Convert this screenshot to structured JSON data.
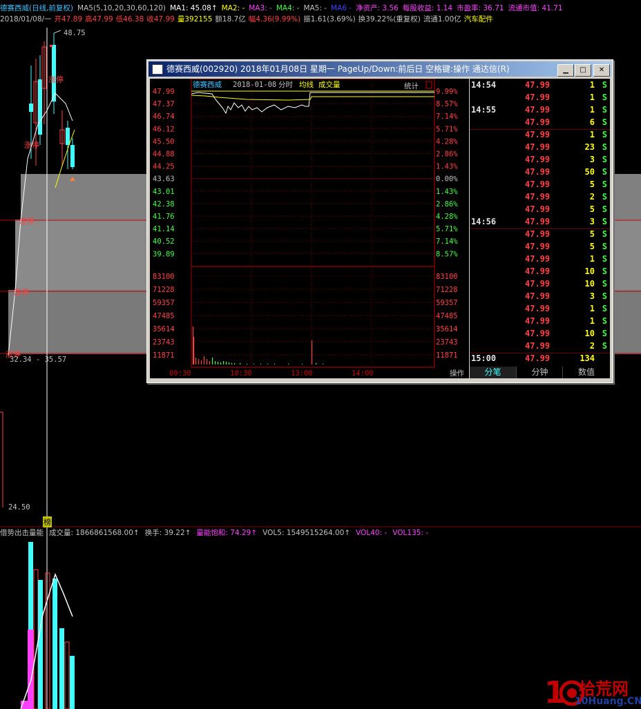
{
  "header": {
    "line1": [
      {
        "text": "德赛西威(日线,前复权)",
        "color": "#40c0ff"
      },
      {
        "text": "MA5(5,10,20,30,60,120)",
        "color": "#c0c0c0"
      },
      {
        "text": "MA1: 45.08↑",
        "color": "#ffffff"
      },
      {
        "text": "MA2: -",
        "color": "#ffff00"
      },
      {
        "text": "MA3: -",
        "color": "#ff40ff"
      },
      {
        "text": "MA4: -",
        "color": "#40ff40"
      },
      {
        "text": "MA5: -",
        "color": "#c0c0c0"
      },
      {
        "text": "MA6 -",
        "color": "#4040ff"
      },
      {
        "text": "净资产: 3.56",
        "color": "#ff40ff"
      },
      {
        "text": "每股收益: 1.14",
        "color": "#ff40ff"
      },
      {
        "text": "市盈率: 36.71",
        "color": "#ff40ff"
      },
      {
        "text": "流通市值: 41.71",
        "color": "#ff40ff"
      }
    ],
    "line2": [
      {
        "text": "2018/01/08/一",
        "color": "#c0c0c0"
      },
      {
        "text": "开47.89",
        "color": "#ff4040"
      },
      {
        "text": "高47.99",
        "color": "#ff4040"
      },
      {
        "text": "低46.38",
        "color": "#ff4040"
      },
      {
        "text": "收47.99",
        "color": "#ff4040"
      },
      {
        "text": "量392155",
        "color": "#ffff00"
      },
      {
        "text": "额18.7亿",
        "color": "#c0c0c0"
      },
      {
        "text": "幅4.36(9.99%)",
        "color": "#ff4040"
      },
      {
        "text": "振1.61(3.69%)",
        "color": "#c0c0c0"
      },
      {
        "text": "换39.22%(重复权)",
        "color": "#c0c0c0"
      },
      {
        "text": "流通1.00亿",
        "color": "#c0c0c0"
      },
      {
        "text": "汽车配件",
        "color": "#ffff00"
      }
    ]
  },
  "kline": {
    "high_label": "48.75",
    "low_label": "24.50",
    "range_label": "32.34 - 35.57",
    "limit_up_label": "涨停",
    "marker": "榜"
  },
  "volume_panel": {
    "items": [
      {
        "text": "借势出击量能",
        "color": "#c0c0c0"
      },
      {
        "text": "成交量: 1866861568.00↑",
        "color": "#c0c0c0"
      },
      {
        "text": "换手: 39.22↑",
        "color": "#c0c0c0"
      },
      {
        "text": "量能饱和: 74.29↑",
        "color": "#ff40ff"
      },
      {
        "text": "VOL5: 1549515264.00↑",
        "color": "#c0c0c0"
      },
      {
        "text": "VOL40: -",
        "color": "#ff40ff"
      },
      {
        "text": "VOL135: -",
        "color": "#ff40ff"
      }
    ]
  },
  "popup": {
    "title": "德赛西威(002920) 2018年01月08日 星期一 PageUp/Down:前后日 空格键:操作 通达信(R)",
    "chart_title": {
      "name": "德赛西威",
      "date": "2018-01-08",
      "type": "分时",
      "avg": "均线",
      "vol": "成交量",
      "stats": "统计"
    },
    "price_labels": [
      "47.99",
      "47.37",
      "46.74",
      "46.12",
      "45.50",
      "44.88",
      "44.25",
      "43.63",
      "43.01",
      "42.38",
      "41.76",
      "41.14",
      "40.52",
      "39.89"
    ],
    "pct_labels": [
      "9.99%",
      "8.57%",
      "7.14%",
      "5.71%",
      "4.28%",
      "2.86%",
      "1.43%",
      "0.00%",
      "1.43%",
      "2.86%",
      "4.28%",
      "5.71%",
      "7.14%",
      "8.57%"
    ],
    "vol_labels": [
      "83100",
      "71228",
      "59357",
      "47485",
      "35614",
      "23743",
      "11871"
    ],
    "time_labels": [
      "09:30",
      "10:30",
      "13:00",
      "14:00"
    ],
    "op_label": "操作",
    "tabs": [
      "分笔",
      "分钟",
      "数值"
    ],
    "ticks": [
      {
        "time": "14:54",
        "price": "47.99",
        "vol": "1",
        "dir": "S"
      },
      {
        "time": "",
        "price": "47.99",
        "vol": "1",
        "dir": "S"
      },
      {
        "time": "14:55",
        "price": "47.99",
        "vol": "1",
        "dir": "S"
      },
      {
        "time": "",
        "price": "47.99",
        "vol": "6",
        "dir": "S"
      },
      {
        "time": "",
        "price": "47.99",
        "vol": "1",
        "dir": "S"
      },
      {
        "time": "",
        "price": "47.99",
        "vol": "23",
        "dir": "S"
      },
      {
        "time": "",
        "price": "47.99",
        "vol": "3",
        "dir": "S"
      },
      {
        "time": "",
        "price": "47.99",
        "vol": "50",
        "dir": "S"
      },
      {
        "time": "",
        "price": "47.99",
        "vol": "5",
        "dir": "S"
      },
      {
        "time": "",
        "price": "47.99",
        "vol": "2",
        "dir": "S"
      },
      {
        "time": "",
        "price": "47.99",
        "vol": "5",
        "dir": "S"
      },
      {
        "time": "14:56",
        "price": "47.99",
        "vol": "3",
        "dir": "S"
      },
      {
        "time": "",
        "price": "47.99",
        "vol": "5",
        "dir": "S"
      },
      {
        "time": "",
        "price": "47.99",
        "vol": "5",
        "dir": "S"
      },
      {
        "time": "",
        "price": "47.99",
        "vol": "1",
        "dir": "S"
      },
      {
        "time": "",
        "price": "47.99",
        "vol": "10",
        "dir": "S"
      },
      {
        "time": "",
        "price": "47.99",
        "vol": "10",
        "dir": "S"
      },
      {
        "time": "",
        "price": "47.99",
        "vol": "3",
        "dir": "S"
      },
      {
        "time": "",
        "price": "47.99",
        "vol": "1",
        "dir": "S"
      },
      {
        "time": "",
        "price": "47.99",
        "vol": "1",
        "dir": "S"
      },
      {
        "time": "",
        "price": "47.99",
        "vol": "10",
        "dir": "S"
      },
      {
        "time": "",
        "price": "47.99",
        "vol": "2",
        "dir": "S"
      },
      {
        "time": "15:00",
        "price": "47.99",
        "vol": "134",
        "dir": ""
      }
    ]
  },
  "watermark": {
    "text1": "拾荒网",
    "text2": "10Huang.CN"
  },
  "colors": {
    "up": "#ff4040",
    "down": "#40ffff",
    "yellow": "#ffff00",
    "white": "#ffffff",
    "green": "#40ff40"
  }
}
